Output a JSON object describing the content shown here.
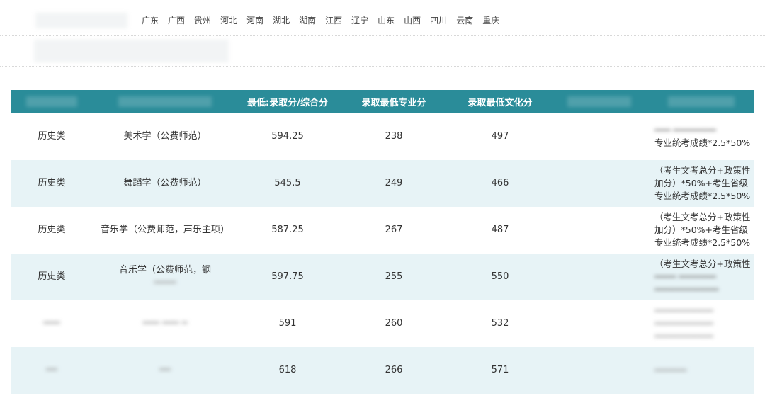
{
  "provinces": [
    "广东",
    "广西",
    "贵州",
    "河北",
    "河南",
    "湖北",
    "湖南",
    "江西",
    "辽宁",
    "山东",
    "山西",
    "四川",
    "云南",
    "重庆"
  ],
  "table": {
    "headers": [
      "",
      "",
      "最低:录取分/综合分",
      "录取最低专业分",
      "录取最低文化分",
      "",
      ""
    ],
    "rows": [
      {
        "category": "历史类",
        "major": "美术学（公费师范）",
        "composite": "594.25",
        "pro": "238",
        "culture": "497",
        "rule": "专业统考成绩*2.5*50%"
      },
      {
        "category": "历史类",
        "major": "舞蹈学（公费师范）",
        "composite": "545.5",
        "pro": "249",
        "culture": "466",
        "rule": "（考生文考总分+政策性加分）*50%+考生省级专业统考成绩*2.5*50%"
      },
      {
        "category": "历史类",
        "major": "音乐学（公费师范，声乐主项）",
        "composite": "587.25",
        "pro": "267",
        "culture": "487",
        "rule": "（考生文考总分+政策性加分）*50%+考生省级专业统考成绩*2.5*50%"
      },
      {
        "category": "历史类",
        "major": "音乐学（公费师范，钢",
        "composite": "597.75",
        "pro": "255",
        "culture": "550",
        "rule": "（考生文考总分+政策性"
      },
      {
        "category": "",
        "major": "",
        "composite": "591",
        "pro": "260",
        "culture": "532",
        "rule": ""
      },
      {
        "category": "",
        "major": "",
        "composite": "618",
        "pro": "266",
        "culture": "571",
        "rule": ""
      }
    ]
  }
}
